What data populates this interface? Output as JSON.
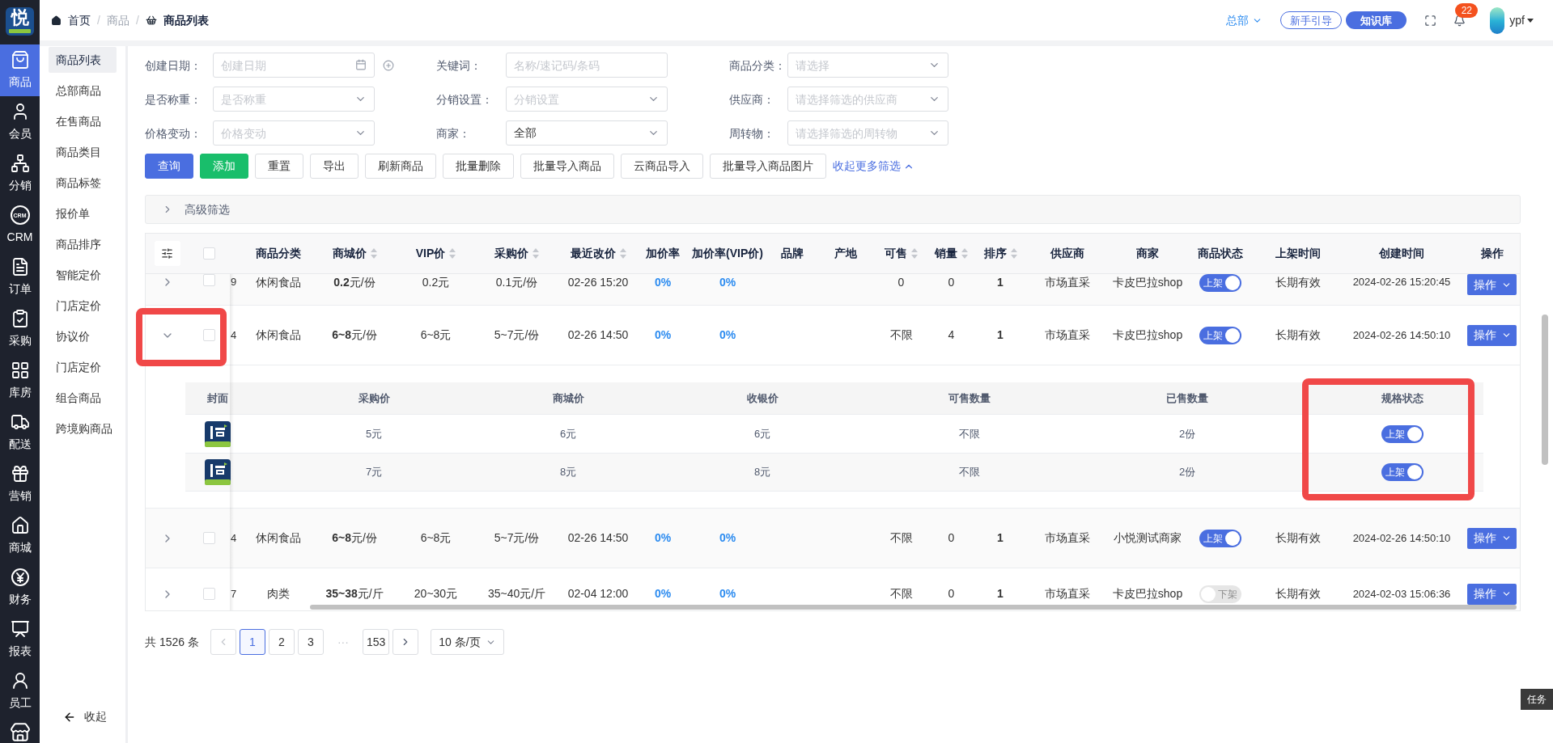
{
  "app": {
    "logo_text": "悦"
  },
  "nav": [
    {
      "label": "商品",
      "selected": true
    },
    {
      "label": "会员",
      "selected": false
    },
    {
      "label": "分销",
      "selected": false
    },
    {
      "label": "CRM",
      "icon_text": "CRM",
      "selected": false
    },
    {
      "label": "订单",
      "selected": false
    },
    {
      "label": "采购",
      "selected": false
    },
    {
      "label": "库房",
      "selected": false
    },
    {
      "label": "配送",
      "selected": false
    },
    {
      "label": "营销",
      "selected": false
    },
    {
      "label": "商城",
      "selected": false
    },
    {
      "label": "财务",
      "selected": false
    },
    {
      "label": "报表",
      "selected": false
    },
    {
      "label": "员工",
      "selected": false
    }
  ],
  "submenu": {
    "items": [
      {
        "label": "商品列表",
        "selected": true
      },
      {
        "label": "总部商品",
        "selected": false
      },
      {
        "label": "在售商品",
        "selected": false
      },
      {
        "label": "商品类目",
        "selected": false
      },
      {
        "label": "商品标签",
        "selected": false
      },
      {
        "label": "报价单",
        "selected": false
      },
      {
        "label": "商品排序",
        "selected": false
      },
      {
        "label": "智能定价",
        "selected": false
      },
      {
        "label": "门店定价",
        "selected": false
      },
      {
        "label": "协议价",
        "selected": false
      },
      {
        "label": "门店定价",
        "selected": false
      },
      {
        "label": "组合商品",
        "selected": false
      },
      {
        "label": "跨境购商品",
        "selected": false
      }
    ],
    "collapse_label": "收起"
  },
  "topbar": {
    "breadcrumb": [
      {
        "label": "首页",
        "kind": "home"
      },
      {
        "label": "商品",
        "kind": "plain"
      },
      {
        "label": "商品列表",
        "kind": "current"
      }
    ],
    "separator": "/",
    "org": "总部",
    "guide_button": "新手引导",
    "kb_button": "知识库",
    "notifications": "22",
    "user": "ypf"
  },
  "filters": [
    {
      "label": "创建日期：",
      "kind": "date",
      "placeholder": "创建日期"
    },
    {
      "label": "关键词：",
      "kind": "text",
      "placeholder": "名称/速记码/条码"
    },
    {
      "label": "商品分类：",
      "kind": "select",
      "placeholder": "请选择"
    },
    {
      "label": "是否称重：",
      "kind": "select",
      "placeholder": "是否称重"
    },
    {
      "label": "分销设置：",
      "kind": "select",
      "placeholder": "分销设置"
    },
    {
      "label": "供应商：",
      "kind": "select",
      "placeholder": "请选择筛选的供应商"
    },
    {
      "label": "价格变动：",
      "kind": "select",
      "placeholder": "价格变动"
    },
    {
      "label": "商家：",
      "kind": "select",
      "value": "全部"
    },
    {
      "label": "周转物：",
      "kind": "select",
      "placeholder": "请选择筛选的周转物"
    }
  ],
  "actions": [
    {
      "label": "查询",
      "kind": "primary"
    },
    {
      "label": "添加",
      "kind": "success"
    },
    {
      "label": "重置",
      "kind": "default"
    },
    {
      "label": "导出",
      "kind": "default"
    },
    {
      "label": "刷新商品",
      "kind": "default"
    },
    {
      "label": "批量删除",
      "kind": "default"
    },
    {
      "label": "批量导入商品",
      "kind": "default"
    },
    {
      "label": "云商品导入",
      "kind": "default"
    },
    {
      "label": "批量导入商品图片",
      "kind": "default"
    }
  ],
  "more_filters_link": "收起更多筛选",
  "advanced_filter": {
    "label": "高级筛选",
    "expanded": false
  },
  "table": {
    "select_all_checked": false,
    "columns": [
      {
        "label": "商品分类",
        "sortable": false
      },
      {
        "label": "商城价",
        "sortable": true
      },
      {
        "label": "VIP价",
        "sortable": true
      },
      {
        "label": "采购价",
        "sortable": true
      },
      {
        "label": "最近改价",
        "sortable": true
      },
      {
        "label": "加价率",
        "sortable": false
      },
      {
        "label": "加价率(VIP价)",
        "sortable": false
      },
      {
        "label": "品牌",
        "sortable": false
      },
      {
        "label": "产地",
        "sortable": false
      },
      {
        "label": "可售",
        "sortable": true
      },
      {
        "label": "销量",
        "sortable": true
      },
      {
        "label": "排序",
        "sortable": true
      },
      {
        "label": "供应商",
        "sortable": false
      },
      {
        "label": "商家",
        "sortable": false
      },
      {
        "label": "商品状态",
        "sortable": false
      },
      {
        "label": "上架时间",
        "sortable": false
      },
      {
        "label": "创建时间",
        "sortable": false
      },
      {
        "label": "操作",
        "sortable": false
      }
    ],
    "rows": [
      {
        "expanded": false,
        "checked": false,
        "highlight": false,
        "index_fragment": "9",
        "category": "休闲食品",
        "mall_price": "**0.2**元/份",
        "vip_price": "0.2元",
        "purchase_price": "0.1元/份",
        "last_change": "02-26 15:20",
        "markup": "0%",
        "vip_markup": "0%",
        "available": "0",
        "sales": "0",
        "sort": "1",
        "supplier": "市场直采",
        "merchant": "卡皮巴拉shop",
        "status": {
          "label": "上架",
          "on": true
        },
        "listing_time": "长期有效",
        "created": "2024-02-26 15:20:45",
        "action": "操作"
      },
      {
        "expanded": true,
        "checked": false,
        "highlight": true,
        "index_fragment": "4",
        "category": "休闲食品",
        "mall_price": "**6~8**元/份",
        "vip_price": "6~8元",
        "purchase_price": "5~7元/份",
        "last_change": "02-26 14:50",
        "markup": "0%",
        "vip_markup": "0%",
        "available": "不限",
        "sales": "4",
        "sort": "1",
        "supplier": "市场直采",
        "merchant": "卡皮巴拉shop",
        "status": {
          "label": "上架",
          "on": true
        },
        "listing_time": "长期有效",
        "created": "2024-02-26 14:50:10",
        "action": "操作",
        "variants": {
          "highlight_status": true,
          "cover_header": "封面",
          "columns": [
            "采购价",
            "商城价",
            "收银价",
            "可售数量",
            "已售数量"
          ],
          "status_header": "规格状态",
          "rows": [
            {
              "cells": [
                "5元",
                "6元",
                "6元",
                "不限",
                "2份"
              ],
              "status": {
                "label": "上架",
                "on": true
              }
            },
            {
              "cells": [
                "7元",
                "8元",
                "8元",
                "不限",
                "2份"
              ],
              "status": {
                "label": "上架",
                "on": true
              }
            }
          ]
        }
      },
      {
        "expanded": false,
        "checked": false,
        "highlight": false,
        "index_fragment": "4",
        "category": "休闲食品",
        "mall_price": "**6~8**元/份",
        "vip_price": "6~8元",
        "purchase_price": "5~7元/份",
        "last_change": "02-26 14:50",
        "markup": "0%",
        "vip_markup": "0%",
        "available": "不限",
        "sales": "0",
        "sort": "1",
        "supplier": "市场直采",
        "merchant": "小悦测试商家",
        "status": {
          "label": "上架",
          "on": true
        },
        "listing_time": "长期有效",
        "created": "2024-02-26 14:50:10",
        "action": "操作"
      },
      {
        "expanded": false,
        "checked": false,
        "highlight": false,
        "index_fragment": "7",
        "category": "肉类",
        "mall_price": "**35~38**元/斤",
        "vip_price": "20~30元",
        "purchase_price": "35~40元/斤",
        "last_change": "02-04 12:00",
        "markup": "0%",
        "vip_markup": "0%",
        "available": "不限",
        "sales": "0",
        "sort": "1",
        "supplier": "市场直采",
        "merchant": "卡皮巴拉shop",
        "status": {
          "label": "下架",
          "on": false
        },
        "listing_time": "长期有效",
        "created": "2024-02-03 15:06:36",
        "action": "操作"
      }
    ]
  },
  "pagination": {
    "total": "共 1526 条",
    "prev_disabled": true,
    "next_disabled": false,
    "pages": [
      {
        "label": "1",
        "kind": "page",
        "selected": true
      },
      {
        "label": "2",
        "kind": "page",
        "selected": false
      },
      {
        "label": "3",
        "kind": "page",
        "selected": false
      },
      {
        "label": "···",
        "kind": "ellipsis"
      },
      {
        "label": "153",
        "kind": "page",
        "selected": false
      }
    ],
    "page_size": "10 条/页"
  },
  "task_tab": "任务"
}
